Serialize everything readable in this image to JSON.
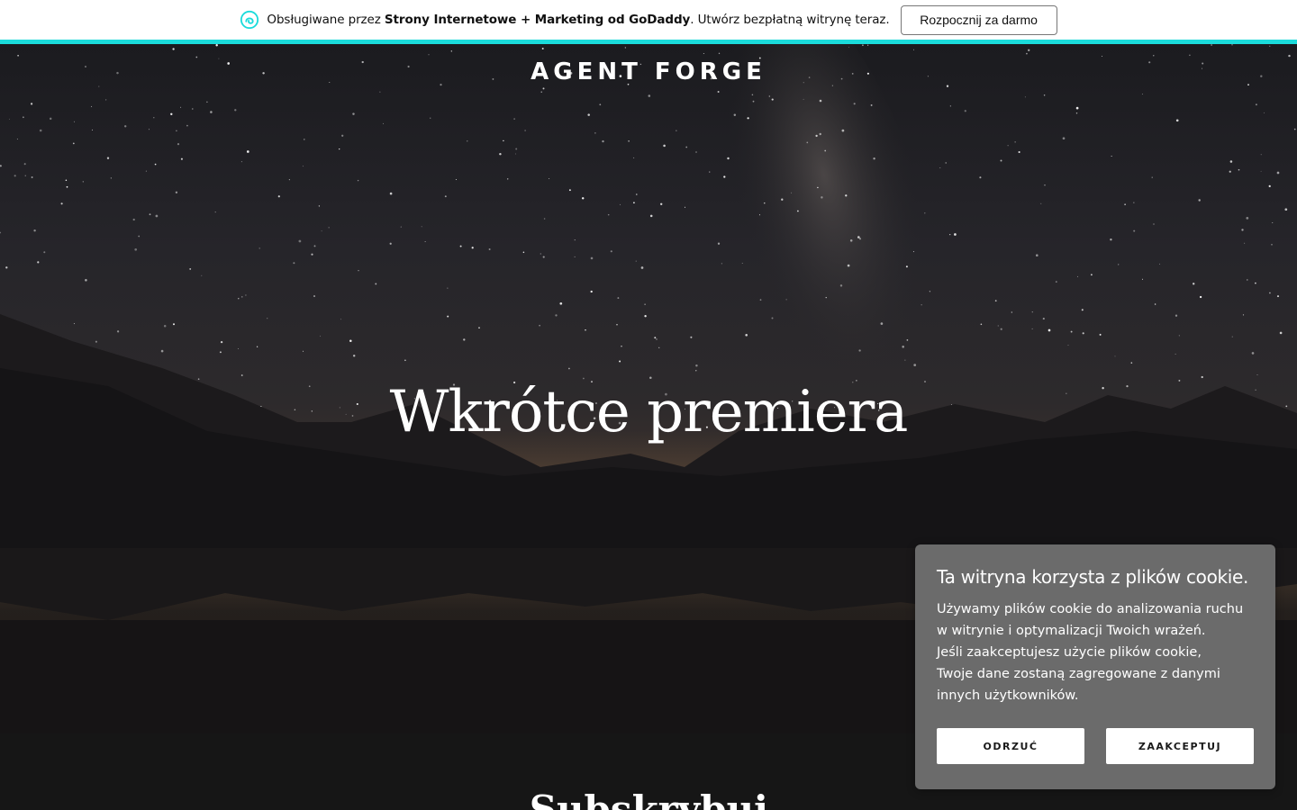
{
  "promo": {
    "prefix": "Obsługiwane przez ",
    "bold": "Strony Internetowe + Marketing od GoDaddy",
    "suffix": ". Utwórz bezpłatną witrynę teraz.",
    "cta_label": "Rozpocznij za darmo",
    "accent_color": "#1bdbdb"
  },
  "hero": {
    "brand": "AGENT FORGE",
    "title": "Wkrótce premiera"
  },
  "subscribe": {
    "title": "Subskrybuj"
  },
  "cookie": {
    "title": "Ta witryna korzysta z plików cookie.",
    "body": "Używamy plików cookie do analizowania ruchu w witrynie i optymalizacji Twoich wrażeń.\nJeśli zaakceptujesz użycie plików cookie,\nTwoje dane zostaną zagregowane z danymi innych użytkowników.",
    "decline_label": "ODRZUĆ",
    "accept_label": "ZAAKCEPTUJ"
  }
}
